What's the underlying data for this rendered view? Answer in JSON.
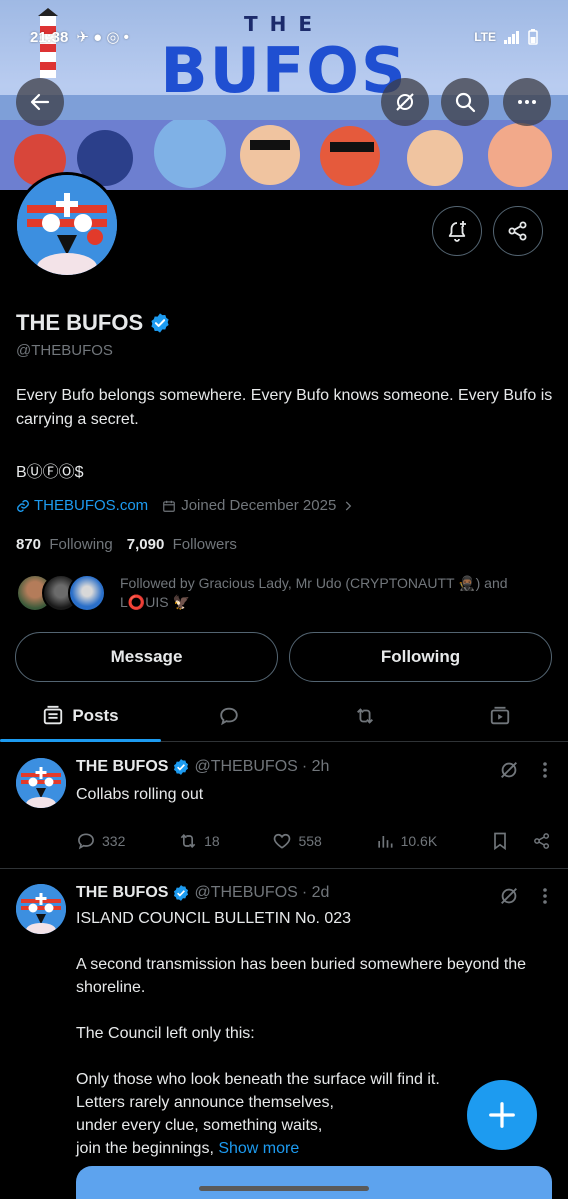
{
  "status_bar": {
    "time": "21:38",
    "network": "LTE"
  },
  "banner": {
    "title_small": "THE",
    "title_main": "BUFOS"
  },
  "header_buttons": {
    "back": "back-arrow-icon",
    "grok": "slash-circle-icon",
    "search": "search-icon",
    "more": "more-icon"
  },
  "profile": {
    "name": "THE BUFOS",
    "handle": "@THEBUFOS",
    "bio": "Every Bufo belongs somewhere. Every Bufo knows someone. Every Bufo is carrying a secret.",
    "bio_symbol": "BⓊⒻⓄ$",
    "website": "THEBUFOS.com",
    "joined": "Joined December 2025",
    "following_count": "870",
    "following_label": "Following",
    "followers_count": "7,090",
    "followers_label": "Followers",
    "followed_by": "Followed by Gracious Lady, Mr Udo (CRYPTONAUTT 🥷🏾) and L⭕UIS 🦅"
  },
  "buttons": {
    "message": "Message",
    "following": "Following"
  },
  "tabs": [
    {
      "label": "Posts"
    }
  ],
  "posts": [
    {
      "name": "THE BUFOS",
      "handle": "@THEBUFOS",
      "time": "· 2h",
      "text": "Collabs rolling out",
      "replies": "332",
      "reposts": "18",
      "likes": "558",
      "views": "10.6K"
    },
    {
      "name": "THE BUFOS",
      "handle": "@THEBUFOS",
      "time": "· 2d",
      "text": "ISLAND COUNCIL BULLETIN No. 023\n\nA second transmission has been buried somewhere beyond the shoreline.\n\nThe Council left only this:\n\nOnly those who look beneath the surface will find it.\nLetters rarely announce themselves,\nunder every clue, something waits,\njoin the beginnings, ",
      "show_more": "Show more"
    }
  ],
  "colors": {
    "accent": "#1d9bf0",
    "background": "#000000",
    "muted": "#71767b"
  }
}
